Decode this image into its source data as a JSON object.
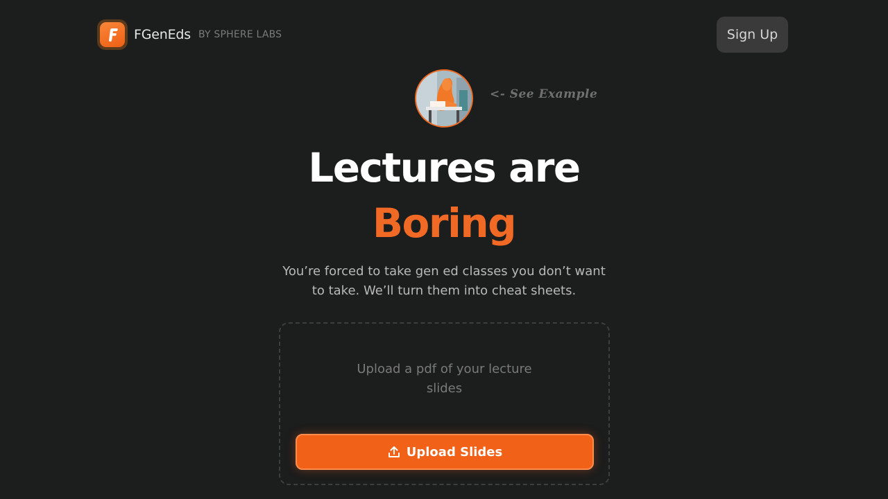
{
  "header": {
    "brand_name": "FGenEds",
    "brand_by": "BY SPHERE LABS",
    "logo_letter": "F",
    "signup_label": "Sign Up"
  },
  "example": {
    "label": "<- See Example"
  },
  "hero": {
    "title": "Lectures are",
    "highlight": "Boring",
    "subtitle": "You’re forced to take gen ed classes you don’t want to take. We’ll turn them into cheat sheets."
  },
  "upload": {
    "instruction": "Upload a pdf of your lecture slides",
    "button_label": "Upload Slides"
  },
  "icons": {
    "logo": "f-logo-icon",
    "upload": "upload-icon"
  },
  "colors": {
    "background": "#1c1d1d",
    "accent": "#f16a25",
    "button": "#f26118",
    "signup_bg": "#3a3a3a"
  }
}
